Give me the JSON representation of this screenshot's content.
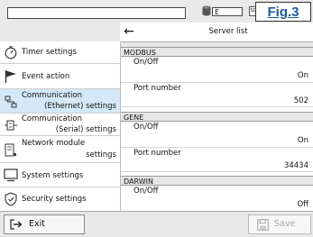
{
  "topbar": {
    "db_field_value": "E",
    "sd_icon_text": "SD",
    "fig_label": "Fig.3"
  },
  "header": {
    "back_icon": "←",
    "title": "Server list"
  },
  "sidebar": {
    "items": [
      {
        "label": "Timer settings",
        "icon": "stopwatch-icon"
      },
      {
        "label": "Event action",
        "icon": "flag-icon"
      },
      {
        "label_line1": "Communication",
        "label_line2": "(Ethernet) settings",
        "icon": "ethernet-icon",
        "active": true
      },
      {
        "label_line1": "Communication",
        "label_line2": "(Serial) settings",
        "icon": "serial-icon"
      },
      {
        "label_line1": "Network module",
        "label_line2": "settings",
        "icon": "network-module-icon"
      },
      {
        "label": "System settings",
        "icon": "monitor-icon"
      },
      {
        "label": "Security settings",
        "icon": "shield-icon"
      }
    ]
  },
  "servers": [
    {
      "name": "MODBUS",
      "rows": [
        {
          "label": "On/Off",
          "value": "On"
        },
        {
          "label": "Port number",
          "value": "502"
        }
      ]
    },
    {
      "name": "GENE",
      "rows": [
        {
          "label": "On/Off",
          "value": "On"
        },
        {
          "label": "Port number",
          "value": "34434"
        }
      ]
    },
    {
      "name": "DARWIN",
      "rows": [
        {
          "label": "On/Off",
          "value": "Off"
        }
      ]
    }
  ],
  "footer": {
    "exit_label": "Exit",
    "save_label": "Save"
  }
}
